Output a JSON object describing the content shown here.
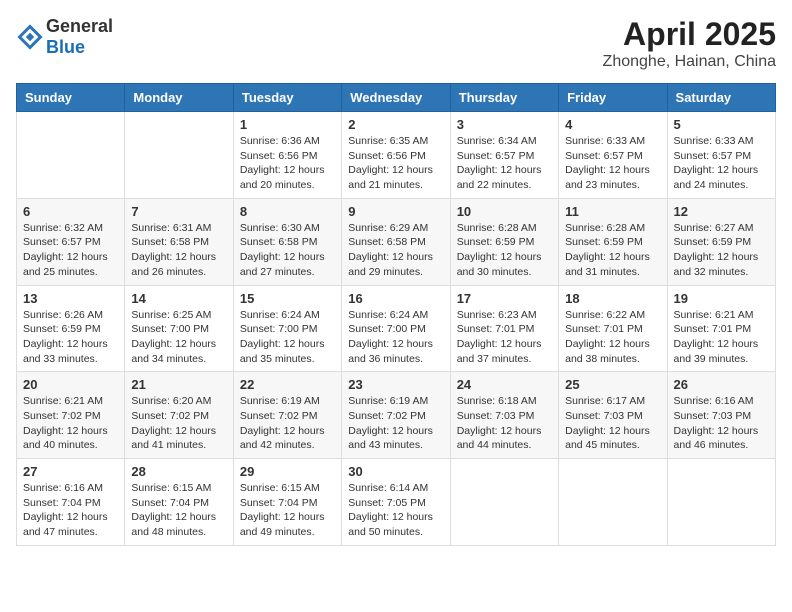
{
  "header": {
    "logo_general": "General",
    "logo_blue": "Blue",
    "title": "April 2025",
    "subtitle": "Zhonghe, Hainan, China"
  },
  "calendar": {
    "days_of_week": [
      "Sunday",
      "Monday",
      "Tuesday",
      "Wednesday",
      "Thursday",
      "Friday",
      "Saturday"
    ],
    "weeks": [
      [
        {
          "day": "",
          "sunrise": "",
          "sunset": "",
          "daylight": ""
        },
        {
          "day": "",
          "sunrise": "",
          "sunset": "",
          "daylight": ""
        },
        {
          "day": "1",
          "sunrise": "Sunrise: 6:36 AM",
          "sunset": "Sunset: 6:56 PM",
          "daylight": "Daylight: 12 hours and 20 minutes."
        },
        {
          "day": "2",
          "sunrise": "Sunrise: 6:35 AM",
          "sunset": "Sunset: 6:56 PM",
          "daylight": "Daylight: 12 hours and 21 minutes."
        },
        {
          "day": "3",
          "sunrise": "Sunrise: 6:34 AM",
          "sunset": "Sunset: 6:57 PM",
          "daylight": "Daylight: 12 hours and 22 minutes."
        },
        {
          "day": "4",
          "sunrise": "Sunrise: 6:33 AM",
          "sunset": "Sunset: 6:57 PM",
          "daylight": "Daylight: 12 hours and 23 minutes."
        },
        {
          "day": "5",
          "sunrise": "Sunrise: 6:33 AM",
          "sunset": "Sunset: 6:57 PM",
          "daylight": "Daylight: 12 hours and 24 minutes."
        }
      ],
      [
        {
          "day": "6",
          "sunrise": "Sunrise: 6:32 AM",
          "sunset": "Sunset: 6:57 PM",
          "daylight": "Daylight: 12 hours and 25 minutes."
        },
        {
          "day": "7",
          "sunrise": "Sunrise: 6:31 AM",
          "sunset": "Sunset: 6:58 PM",
          "daylight": "Daylight: 12 hours and 26 minutes."
        },
        {
          "day": "8",
          "sunrise": "Sunrise: 6:30 AM",
          "sunset": "Sunset: 6:58 PM",
          "daylight": "Daylight: 12 hours and 27 minutes."
        },
        {
          "day": "9",
          "sunrise": "Sunrise: 6:29 AM",
          "sunset": "Sunset: 6:58 PM",
          "daylight": "Daylight: 12 hours and 29 minutes."
        },
        {
          "day": "10",
          "sunrise": "Sunrise: 6:28 AM",
          "sunset": "Sunset: 6:59 PM",
          "daylight": "Daylight: 12 hours and 30 minutes."
        },
        {
          "day": "11",
          "sunrise": "Sunrise: 6:28 AM",
          "sunset": "Sunset: 6:59 PM",
          "daylight": "Daylight: 12 hours and 31 minutes."
        },
        {
          "day": "12",
          "sunrise": "Sunrise: 6:27 AM",
          "sunset": "Sunset: 6:59 PM",
          "daylight": "Daylight: 12 hours and 32 minutes."
        }
      ],
      [
        {
          "day": "13",
          "sunrise": "Sunrise: 6:26 AM",
          "sunset": "Sunset: 6:59 PM",
          "daylight": "Daylight: 12 hours and 33 minutes."
        },
        {
          "day": "14",
          "sunrise": "Sunrise: 6:25 AM",
          "sunset": "Sunset: 7:00 PM",
          "daylight": "Daylight: 12 hours and 34 minutes."
        },
        {
          "day": "15",
          "sunrise": "Sunrise: 6:24 AM",
          "sunset": "Sunset: 7:00 PM",
          "daylight": "Daylight: 12 hours and 35 minutes."
        },
        {
          "day": "16",
          "sunrise": "Sunrise: 6:24 AM",
          "sunset": "Sunset: 7:00 PM",
          "daylight": "Daylight: 12 hours and 36 minutes."
        },
        {
          "day": "17",
          "sunrise": "Sunrise: 6:23 AM",
          "sunset": "Sunset: 7:01 PM",
          "daylight": "Daylight: 12 hours and 37 minutes."
        },
        {
          "day": "18",
          "sunrise": "Sunrise: 6:22 AM",
          "sunset": "Sunset: 7:01 PM",
          "daylight": "Daylight: 12 hours and 38 minutes."
        },
        {
          "day": "19",
          "sunrise": "Sunrise: 6:21 AM",
          "sunset": "Sunset: 7:01 PM",
          "daylight": "Daylight: 12 hours and 39 minutes."
        }
      ],
      [
        {
          "day": "20",
          "sunrise": "Sunrise: 6:21 AM",
          "sunset": "Sunset: 7:02 PM",
          "daylight": "Daylight: 12 hours and 40 minutes."
        },
        {
          "day": "21",
          "sunrise": "Sunrise: 6:20 AM",
          "sunset": "Sunset: 7:02 PM",
          "daylight": "Daylight: 12 hours and 41 minutes."
        },
        {
          "day": "22",
          "sunrise": "Sunrise: 6:19 AM",
          "sunset": "Sunset: 7:02 PM",
          "daylight": "Daylight: 12 hours and 42 minutes."
        },
        {
          "day": "23",
          "sunrise": "Sunrise: 6:19 AM",
          "sunset": "Sunset: 7:02 PM",
          "daylight": "Daylight: 12 hours and 43 minutes."
        },
        {
          "day": "24",
          "sunrise": "Sunrise: 6:18 AM",
          "sunset": "Sunset: 7:03 PM",
          "daylight": "Daylight: 12 hours and 44 minutes."
        },
        {
          "day": "25",
          "sunrise": "Sunrise: 6:17 AM",
          "sunset": "Sunset: 7:03 PM",
          "daylight": "Daylight: 12 hours and 45 minutes."
        },
        {
          "day": "26",
          "sunrise": "Sunrise: 6:16 AM",
          "sunset": "Sunset: 7:03 PM",
          "daylight": "Daylight: 12 hours and 46 minutes."
        }
      ],
      [
        {
          "day": "27",
          "sunrise": "Sunrise: 6:16 AM",
          "sunset": "Sunset: 7:04 PM",
          "daylight": "Daylight: 12 hours and 47 minutes."
        },
        {
          "day": "28",
          "sunrise": "Sunrise: 6:15 AM",
          "sunset": "Sunset: 7:04 PM",
          "daylight": "Daylight: 12 hours and 48 minutes."
        },
        {
          "day": "29",
          "sunrise": "Sunrise: 6:15 AM",
          "sunset": "Sunset: 7:04 PM",
          "daylight": "Daylight: 12 hours and 49 minutes."
        },
        {
          "day": "30",
          "sunrise": "Sunrise: 6:14 AM",
          "sunset": "Sunset: 7:05 PM",
          "daylight": "Daylight: 12 hours and 50 minutes."
        },
        {
          "day": "",
          "sunrise": "",
          "sunset": "",
          "daylight": ""
        },
        {
          "day": "",
          "sunrise": "",
          "sunset": "",
          "daylight": ""
        },
        {
          "day": "",
          "sunrise": "",
          "sunset": "",
          "daylight": ""
        }
      ]
    ]
  }
}
